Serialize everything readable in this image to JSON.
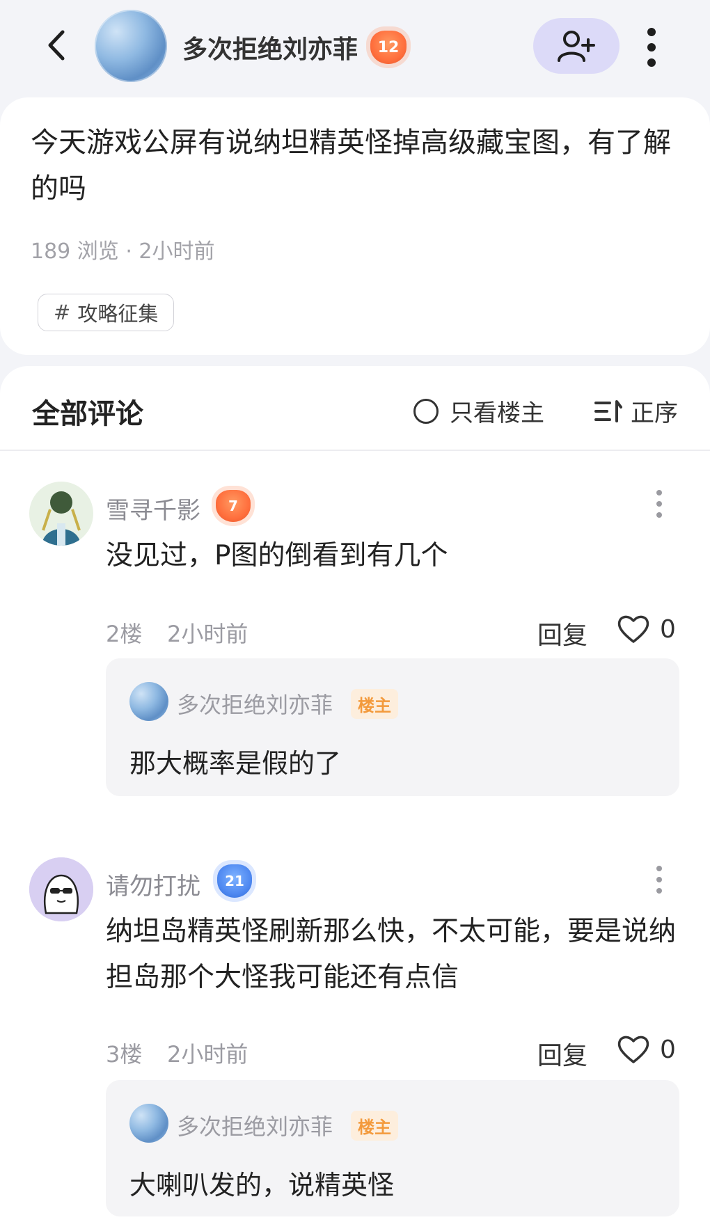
{
  "header": {
    "author_name": "多次拒绝刘亦菲",
    "author_level": "12"
  },
  "post": {
    "title": "今天游戏公屏有说纳坦精英怪掉高级藏宝图，有了解的吗",
    "meta": "189 浏览 · 2小时前",
    "tag": "攻略征集"
  },
  "comments_header": {
    "title": "全部评论",
    "only_op": "只看楼主",
    "sort": "正序"
  },
  "comments": [
    {
      "name": "雪寻千影",
      "level": "7",
      "text": "没见过，P图的倒看到有几个",
      "floor": "2楼",
      "time": "2小时前",
      "reply_label": "回复",
      "likes": "0",
      "reply": {
        "name": "多次拒绝刘亦菲",
        "badge": "楼主",
        "text": "那大概率是假的了"
      }
    },
    {
      "name": "请勿打扰",
      "level": "21",
      "text": "纳坦岛精英怪刷新那么快，不太可能，要是说纳担岛那个大怪我可能还有点信",
      "floor": "3楼",
      "time": "2小时前",
      "reply_label": "回复",
      "likes": "0",
      "reply": {
        "name": "多次拒绝刘亦菲",
        "badge": "楼主",
        "text": "大喇叭发的，说精英怪"
      }
    }
  ]
}
